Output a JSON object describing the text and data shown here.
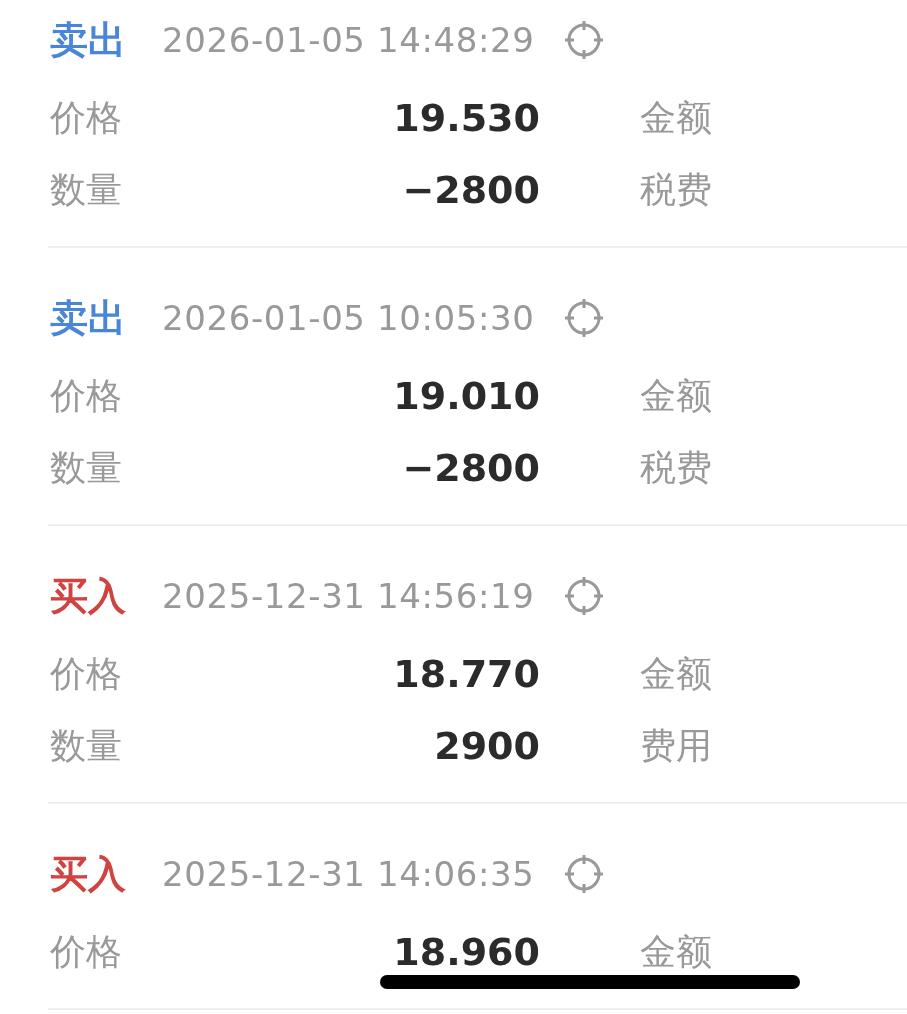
{
  "records": [
    {
      "kind": "sell",
      "side": "卖出",
      "time": "2026-01-05 14:48:29",
      "rows": [
        {
          "label": "价格",
          "value": "19.530",
          "label2": "金额"
        },
        {
          "label": "数量",
          "value": "−2800",
          "label2": "税费"
        }
      ]
    },
    {
      "kind": "sell",
      "side": "卖出",
      "time": "2026-01-05 10:05:30",
      "rows": [
        {
          "label": "价格",
          "value": "19.010",
          "label2": "金额"
        },
        {
          "label": "数量",
          "value": "−2800",
          "label2": "税费"
        }
      ]
    },
    {
      "kind": "buy",
      "side": "买入",
      "time": "2025-12-31 14:56:19",
      "rows": [
        {
          "label": "价格",
          "value": "18.770",
          "label2": "金额"
        },
        {
          "label": "数量",
          "value": "2900",
          "label2": "费用"
        }
      ]
    },
    {
      "kind": "buy",
      "side": "买入",
      "time": "2025-12-31 14:06:35",
      "rows": [
        {
          "label": "价格",
          "value": "18.960",
          "label2": "金额"
        }
      ]
    }
  ]
}
